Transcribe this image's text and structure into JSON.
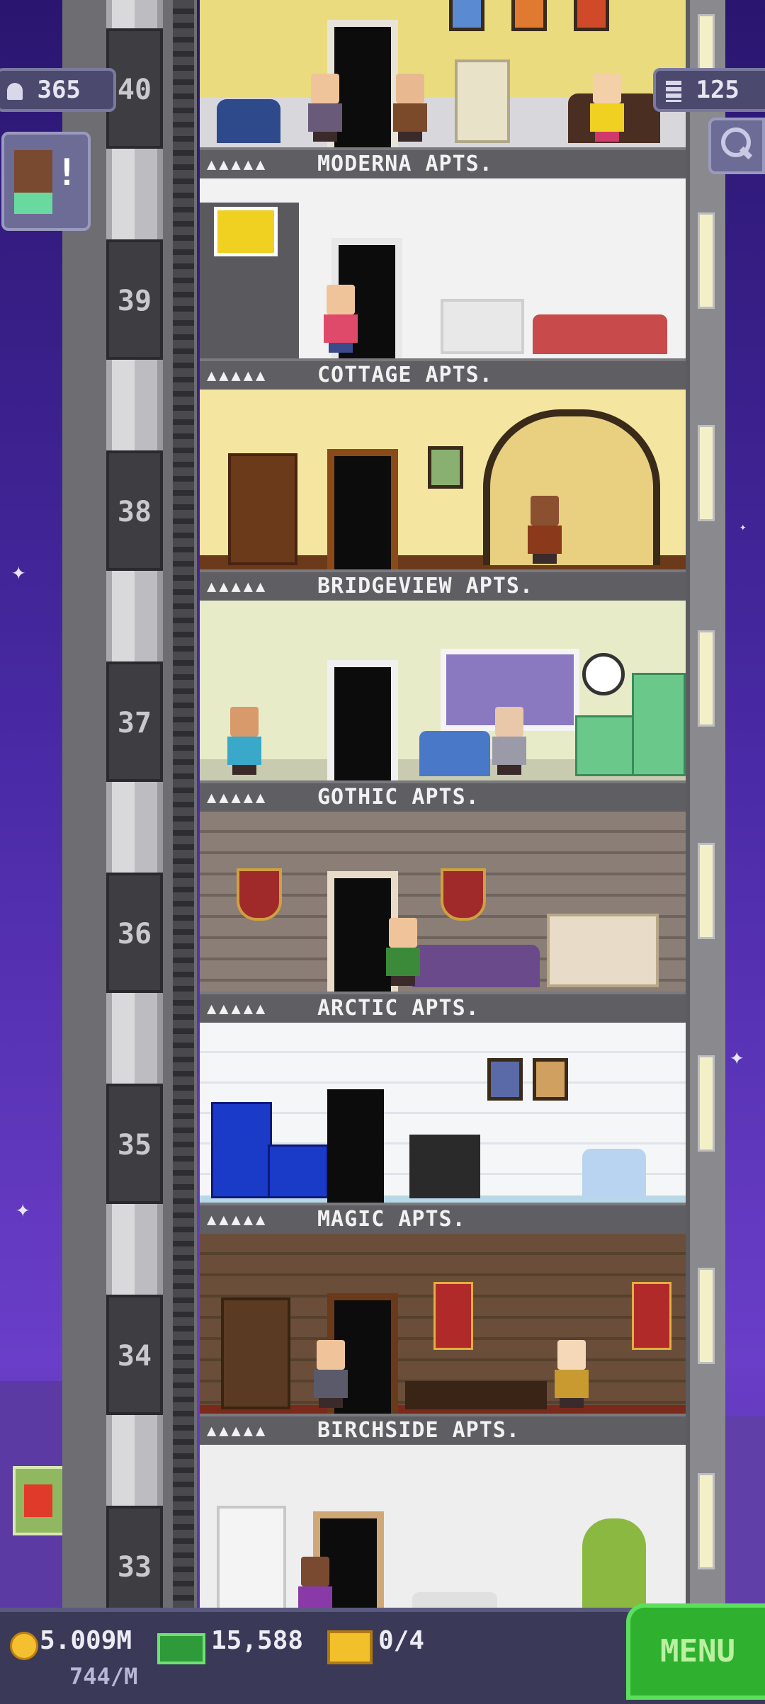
{
  "hud": {
    "population": "365",
    "floor_count": "125",
    "alert_mark": "!"
  },
  "floors": [
    {
      "number": "40",
      "name": "MODERNA APTS.",
      "stars": "▲▲▲▲▲",
      "wall": "#eadc7e"
    },
    {
      "number": "39",
      "name": "COTTAGE APTS.",
      "stars": "▲▲▲▲▲",
      "wall": "#f2f2f2"
    },
    {
      "number": "38",
      "name": "BRIDGEVIEW APTS.",
      "stars": "▲▲▲▲▲",
      "wall": "#f4e6a0"
    },
    {
      "number": "37",
      "name": "GOTHIC APTS.",
      "stars": "▲▲▲▲▲",
      "wall": "#e8ebc8"
    },
    {
      "number": "36",
      "name": "ARCTIC APTS.",
      "stars": "▲▲▲▲▲",
      "wall": "#8a7e76"
    },
    {
      "number": "35",
      "name": "MAGIC APTS.",
      "stars": "▲▲▲▲▲",
      "wall": "#f4f6f8"
    },
    {
      "number": "34",
      "name": "BIRCHSIDE APTS.",
      "stars": "▲▲▲▲▲",
      "wall": "#6a4e3a"
    },
    {
      "number": "33",
      "name": "",
      "stars": "",
      "wall": "#eeeeee"
    }
  ],
  "bottom_bar": {
    "coins": "5.009M",
    "coin_rate": "744/M",
    "bux": "15,588",
    "tickets": "0/4",
    "menu_label": "MENU"
  },
  "icons": {
    "population": "person-icon",
    "floors": "building-icon",
    "search": "magnifier-icon",
    "coin": "coin-icon",
    "bux": "tower-bux-icon",
    "ticket": "ticket-icon"
  },
  "colors": {
    "menu_button": "#2fb02f",
    "hud_panel": "#4b4a6e",
    "sky": "#4a2aa6"
  }
}
